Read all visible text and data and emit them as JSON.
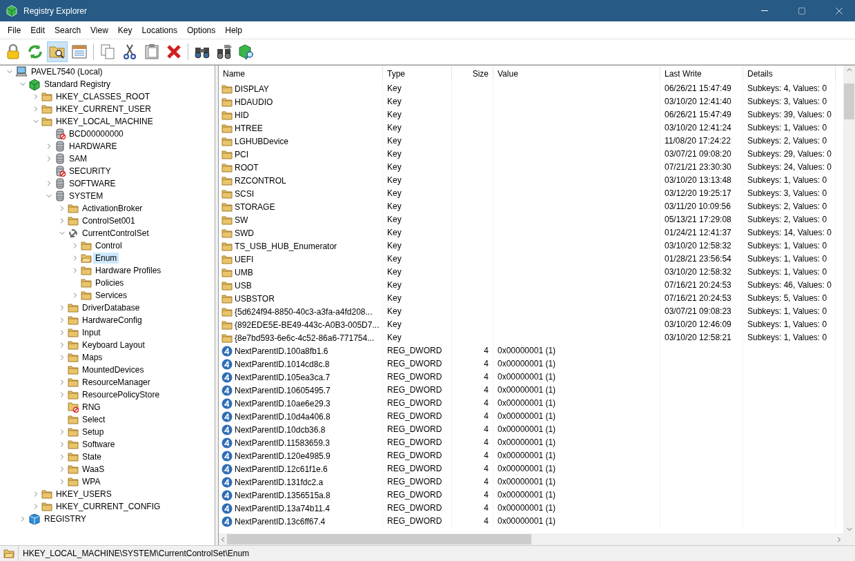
{
  "window": {
    "title": "Registry Explorer"
  },
  "menu": [
    "File",
    "Edit",
    "Search",
    "View",
    "Key",
    "Locations",
    "Options",
    "Help"
  ],
  "toolbar": [
    {
      "kind": "lock",
      "pressed": false
    },
    {
      "kind": "refresh",
      "pressed": false
    },
    {
      "kind": "folder-search",
      "pressed": true
    },
    {
      "kind": "list",
      "pressed": false
    },
    {
      "kind": "sep"
    },
    {
      "kind": "copy",
      "pressed": false
    },
    {
      "kind": "cut",
      "pressed": false
    },
    {
      "kind": "paste",
      "pressed": false
    },
    {
      "kind": "delete",
      "pressed": false
    },
    {
      "kind": "sep"
    },
    {
      "kind": "find",
      "pressed": false
    },
    {
      "kind": "find-next",
      "pressed": false
    },
    {
      "kind": "registry-search",
      "pressed": false
    }
  ],
  "tree": [
    {
      "label": "PAVEL7540 (Local)",
      "kind": "computer",
      "expanded": true,
      "selected": false,
      "children": [
        {
          "label": "Standard Registry",
          "kind": "registry",
          "expanded": true,
          "selected": false,
          "children": [
            {
              "label": "HKEY_CLASSES_ROOT",
              "kind": "folder",
              "expanded": false,
              "selected": false
            },
            {
              "label": "HKEY_CURRENT_USER",
              "kind": "folder",
              "expanded": false,
              "selected": false
            },
            {
              "label": "HKEY_LOCAL_MACHINE",
              "kind": "folder",
              "expanded": true,
              "selected": false,
              "children": [
                {
                  "label": "BCD00000000",
                  "kind": "hive-denied",
                  "selected": false
                },
                {
                  "label": "HARDWARE",
                  "kind": "hive",
                  "expanded": false,
                  "selected": false
                },
                {
                  "label": "SAM",
                  "kind": "hive",
                  "expanded": false,
                  "selected": false
                },
                {
                  "label": "SECURITY",
                  "kind": "hive-denied",
                  "selected": false
                },
                {
                  "label": "SOFTWARE",
                  "kind": "hive",
                  "expanded": false,
                  "selected": false
                },
                {
                  "label": "SYSTEM",
                  "kind": "hive",
                  "expanded": true,
                  "selected": false,
                  "children": [
                    {
                      "label": "ActivationBroker",
                      "kind": "folder",
                      "expanded": false,
                      "selected": false
                    },
                    {
                      "label": "ControlSet001",
                      "kind": "folder",
                      "expanded": false,
                      "selected": false
                    },
                    {
                      "label": "CurrentControlSet",
                      "kind": "link",
                      "expanded": true,
                      "selected": false,
                      "children": [
                        {
                          "label": "Control",
                          "kind": "folder",
                          "expanded": false,
                          "selected": false
                        },
                        {
                          "label": "Enum",
                          "kind": "folder-open",
                          "expanded": false,
                          "selected": true
                        },
                        {
                          "label": "Hardware Profiles",
                          "kind": "folder",
                          "expanded": false,
                          "selected": false
                        },
                        {
                          "label": "Policies",
                          "kind": "folder",
                          "selected": false
                        },
                        {
                          "label": "Services",
                          "kind": "folder",
                          "expanded": false,
                          "selected": false
                        }
                      ]
                    },
                    {
                      "label": "DriverDatabase",
                      "kind": "folder",
                      "expanded": false,
                      "selected": false
                    },
                    {
                      "label": "HardwareConfig",
                      "kind": "folder",
                      "expanded": false,
                      "selected": false
                    },
                    {
                      "label": "Input",
                      "kind": "folder",
                      "expanded": false,
                      "selected": false
                    },
                    {
                      "label": "Keyboard Layout",
                      "kind": "folder",
                      "expanded": false,
                      "selected": false
                    },
                    {
                      "label": "Maps",
                      "kind": "folder",
                      "expanded": false,
                      "selected": false
                    },
                    {
                      "label": "MountedDevices",
                      "kind": "folder",
                      "selected": false
                    },
                    {
                      "label": "ResourceManager",
                      "kind": "folder",
                      "expanded": false,
                      "selected": false
                    },
                    {
                      "label": "ResourcePolicyStore",
                      "kind": "folder",
                      "expanded": false,
                      "selected": false
                    },
                    {
                      "label": "RNG",
                      "kind": "folder-denied",
                      "selected": false
                    },
                    {
                      "label": "Select",
                      "kind": "folder",
                      "selected": false
                    },
                    {
                      "label": "Setup",
                      "kind": "folder",
                      "expanded": false,
                      "selected": false
                    },
                    {
                      "label": "Software",
                      "kind": "folder",
                      "expanded": false,
                      "selected": false
                    },
                    {
                      "label": "State",
                      "kind": "folder",
                      "expanded": false,
                      "selected": false
                    },
                    {
                      "label": "WaaS",
                      "kind": "folder",
                      "expanded": false,
                      "selected": false
                    },
                    {
                      "label": "WPA",
                      "kind": "folder",
                      "expanded": false,
                      "selected": false
                    }
                  ]
                }
              ]
            },
            {
              "label": "HKEY_USERS",
              "kind": "folder",
              "expanded": false,
              "selected": false
            },
            {
              "label": "HKEY_CURRENT_CONFIG",
              "kind": "folder",
              "expanded": false,
              "selected": false
            }
          ]
        },
        {
          "label": "REGISTRY",
          "kind": "cube",
          "expanded": false,
          "selected": false
        }
      ]
    }
  ],
  "table": {
    "columns": [
      "Name",
      "Type",
      "Size",
      "Value",
      "Last Write",
      "Details"
    ],
    "rows": [
      {
        "kind": "key",
        "name": "DISPLAY",
        "type": "Key",
        "last_write": "06/26/21 15:47:49",
        "details": "Subkeys: 4, Values: 0"
      },
      {
        "kind": "key",
        "name": "HDAUDIO",
        "type": "Key",
        "last_write": "03/10/20 12:41:40",
        "details": "Subkeys: 3, Values: 0"
      },
      {
        "kind": "key",
        "name": "HID",
        "type": "Key",
        "last_write": "06/26/21 15:47:49",
        "details": "Subkeys: 39, Values: 0"
      },
      {
        "kind": "key",
        "name": "HTREE",
        "type": "Key",
        "last_write": "03/10/20 12:41:24",
        "details": "Subkeys: 1, Values: 0"
      },
      {
        "kind": "key",
        "name": "LGHUBDevice",
        "type": "Key",
        "last_write": "11/08/20 17:24:22",
        "details": "Subkeys: 2, Values: 0"
      },
      {
        "kind": "key",
        "name": "PCI",
        "type": "Key",
        "last_write": "03/07/21 09:08:20",
        "details": "Subkeys: 29, Values: 0"
      },
      {
        "kind": "key",
        "name": "ROOT",
        "type": "Key",
        "last_write": "07/21/21 23:30:30",
        "details": "Subkeys: 24, Values: 0"
      },
      {
        "kind": "key",
        "name": "RZCONTROL",
        "type": "Key",
        "last_write": "03/10/20 13:13:48",
        "details": "Subkeys: 1, Values: 0"
      },
      {
        "kind": "key",
        "name": "SCSI",
        "type": "Key",
        "last_write": "03/12/20 19:25:17",
        "details": "Subkeys: 3, Values: 0"
      },
      {
        "kind": "key",
        "name": "STORAGE",
        "type": "Key",
        "last_write": "03/11/20 10:09:56",
        "details": "Subkeys: 2, Values: 0"
      },
      {
        "kind": "key",
        "name": "SW",
        "type": "Key",
        "last_write": "05/13/21 17:29:08",
        "details": "Subkeys: 2, Values: 0"
      },
      {
        "kind": "key",
        "name": "SWD",
        "type": "Key",
        "last_write": "01/24/21 12:41:37",
        "details": "Subkeys: 14, Values: 0"
      },
      {
        "kind": "key",
        "name": "TS_USB_HUB_Enumerator",
        "type": "Key",
        "last_write": "03/10/20 12:58:32",
        "details": "Subkeys: 1, Values: 0"
      },
      {
        "kind": "key",
        "name": "UEFI",
        "type": "Key",
        "last_write": "01/28/21 23:56:54",
        "details": "Subkeys: 1, Values: 0"
      },
      {
        "kind": "key",
        "name": "UMB",
        "type": "Key",
        "last_write": "03/10/20 12:58:32",
        "details": "Subkeys: 1, Values: 0"
      },
      {
        "kind": "key",
        "name": "USB",
        "type": "Key",
        "last_write": "07/16/21 20:24:53",
        "details": "Subkeys: 46, Values: 0"
      },
      {
        "kind": "key",
        "name": "USBSTOR",
        "type": "Key",
        "last_write": "07/16/21 20:24:53",
        "details": "Subkeys: 5, Values: 0"
      },
      {
        "kind": "key",
        "name": "{5d624f94-8850-40c3-a3fa-a4fd208...",
        "type": "Key",
        "last_write": "03/07/21 09:08:23",
        "details": "Subkeys: 1, Values: 0"
      },
      {
        "kind": "key",
        "name": "{892EDE5E-BE49-443c-A0B3-005D7...",
        "type": "Key",
        "last_write": "03/10/20 12:46:09",
        "details": "Subkeys: 1, Values: 0"
      },
      {
        "kind": "key",
        "name": "{8e7bd593-6e6c-4c52-86a6-771754...",
        "type": "Key",
        "last_write": "03/10/20 12:58:21",
        "details": "Subkeys: 1, Values: 0"
      },
      {
        "kind": "dword",
        "name": "NextParentID.100a8fb1.6",
        "type": "REG_DWORD",
        "size": "4",
        "value": "0x00000001 (1)"
      },
      {
        "kind": "dword",
        "name": "NextParentID.1014cd8c.8",
        "type": "REG_DWORD",
        "size": "4",
        "value": "0x00000001 (1)"
      },
      {
        "kind": "dword",
        "name": "NextParentID.105ea3ca.7",
        "type": "REG_DWORD",
        "size": "4",
        "value": "0x00000001 (1)"
      },
      {
        "kind": "dword",
        "name": "NextParentID.10605495.7",
        "type": "REG_DWORD",
        "size": "4",
        "value": "0x00000001 (1)"
      },
      {
        "kind": "dword",
        "name": "NextParentID.10ae6e29.3",
        "type": "REG_DWORD",
        "size": "4",
        "value": "0x00000001 (1)"
      },
      {
        "kind": "dword",
        "name": "NextParentID.10d4a406.8",
        "type": "REG_DWORD",
        "size": "4",
        "value": "0x00000001 (1)"
      },
      {
        "kind": "dword",
        "name": "NextParentID.10dcb36.8",
        "type": "REG_DWORD",
        "size": "4",
        "value": "0x00000001 (1)"
      },
      {
        "kind": "dword",
        "name": "NextParentID.11583659.3",
        "type": "REG_DWORD",
        "size": "4",
        "value": "0x00000001 (1)"
      },
      {
        "kind": "dword",
        "name": "NextParentID.120e4985.9",
        "type": "REG_DWORD",
        "size": "4",
        "value": "0x00000001 (1)"
      },
      {
        "kind": "dword",
        "name": "NextParentID.12c61f1e.6",
        "type": "REG_DWORD",
        "size": "4",
        "value": "0x00000001 (1)"
      },
      {
        "kind": "dword",
        "name": "NextParentID.131fdc2.a",
        "type": "REG_DWORD",
        "size": "4",
        "value": "0x00000001 (1)"
      },
      {
        "kind": "dword",
        "name": "NextParentID.1356515a.8",
        "type": "REG_DWORD",
        "size": "4",
        "value": "0x00000001 (1)"
      },
      {
        "kind": "dword",
        "name": "NextParentID.13a74b11.4",
        "type": "REG_DWORD",
        "size": "4",
        "value": "0x00000001 (1)"
      },
      {
        "kind": "dword",
        "name": "NextParentID.13c6ff67.4",
        "type": "REG_DWORD",
        "size": "4",
        "value": "0x00000001 (1)"
      }
    ]
  },
  "status_bar": {
    "path": "HKEY_LOCAL_MACHINE\\SYSTEM\\CurrentControlSet\\Enum"
  }
}
